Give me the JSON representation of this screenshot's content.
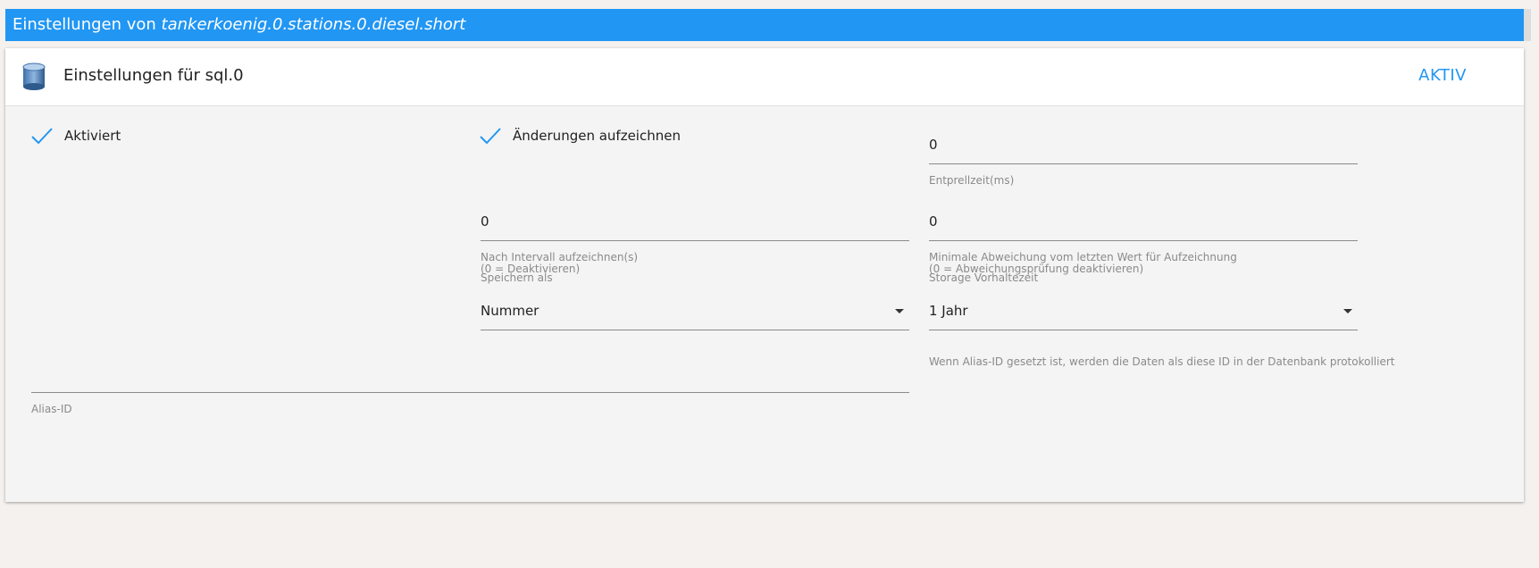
{
  "window": {
    "title_prefix": "Einstellungen von ",
    "title_object": "tankerkoenig.0.stations.0.diesel.short"
  },
  "panel": {
    "title": "Einstellungen für sql.0",
    "status": "AKTIV",
    "icon": "database-icon"
  },
  "settings": {
    "enabled_label": "Aktiviert",
    "record_changes_label": "Änderungen aufzeichnen",
    "debounce": {
      "value": "0",
      "label": "Entprellzeit(ms)"
    },
    "interval": {
      "value": "0",
      "help_line1": "Nach Intervall aufzeichnen(s)",
      "help_line2": "(0 = Deaktivieren)"
    },
    "min_deviation": {
      "value": "0",
      "help_line1": "Minimale Abweichung vom letzten Wert für Aufzeichnung",
      "help_line2": "(0 = Abweichungsprüfung deaktivieren)"
    },
    "store_as": {
      "label": "Speichern als",
      "value": "Nummer"
    },
    "retention": {
      "label": "Storage Vorhaltezeit",
      "value": "1 Jahr"
    },
    "alias_hint": "Wenn Alias-ID gesetzt ist, werden die Daten als diese ID in der Datenbank protokolliert",
    "alias": {
      "value": "",
      "label": "Alias-ID"
    }
  },
  "colors": {
    "accent": "#2196f3",
    "check": "#2196f3",
    "background": "#f4f4f4"
  }
}
